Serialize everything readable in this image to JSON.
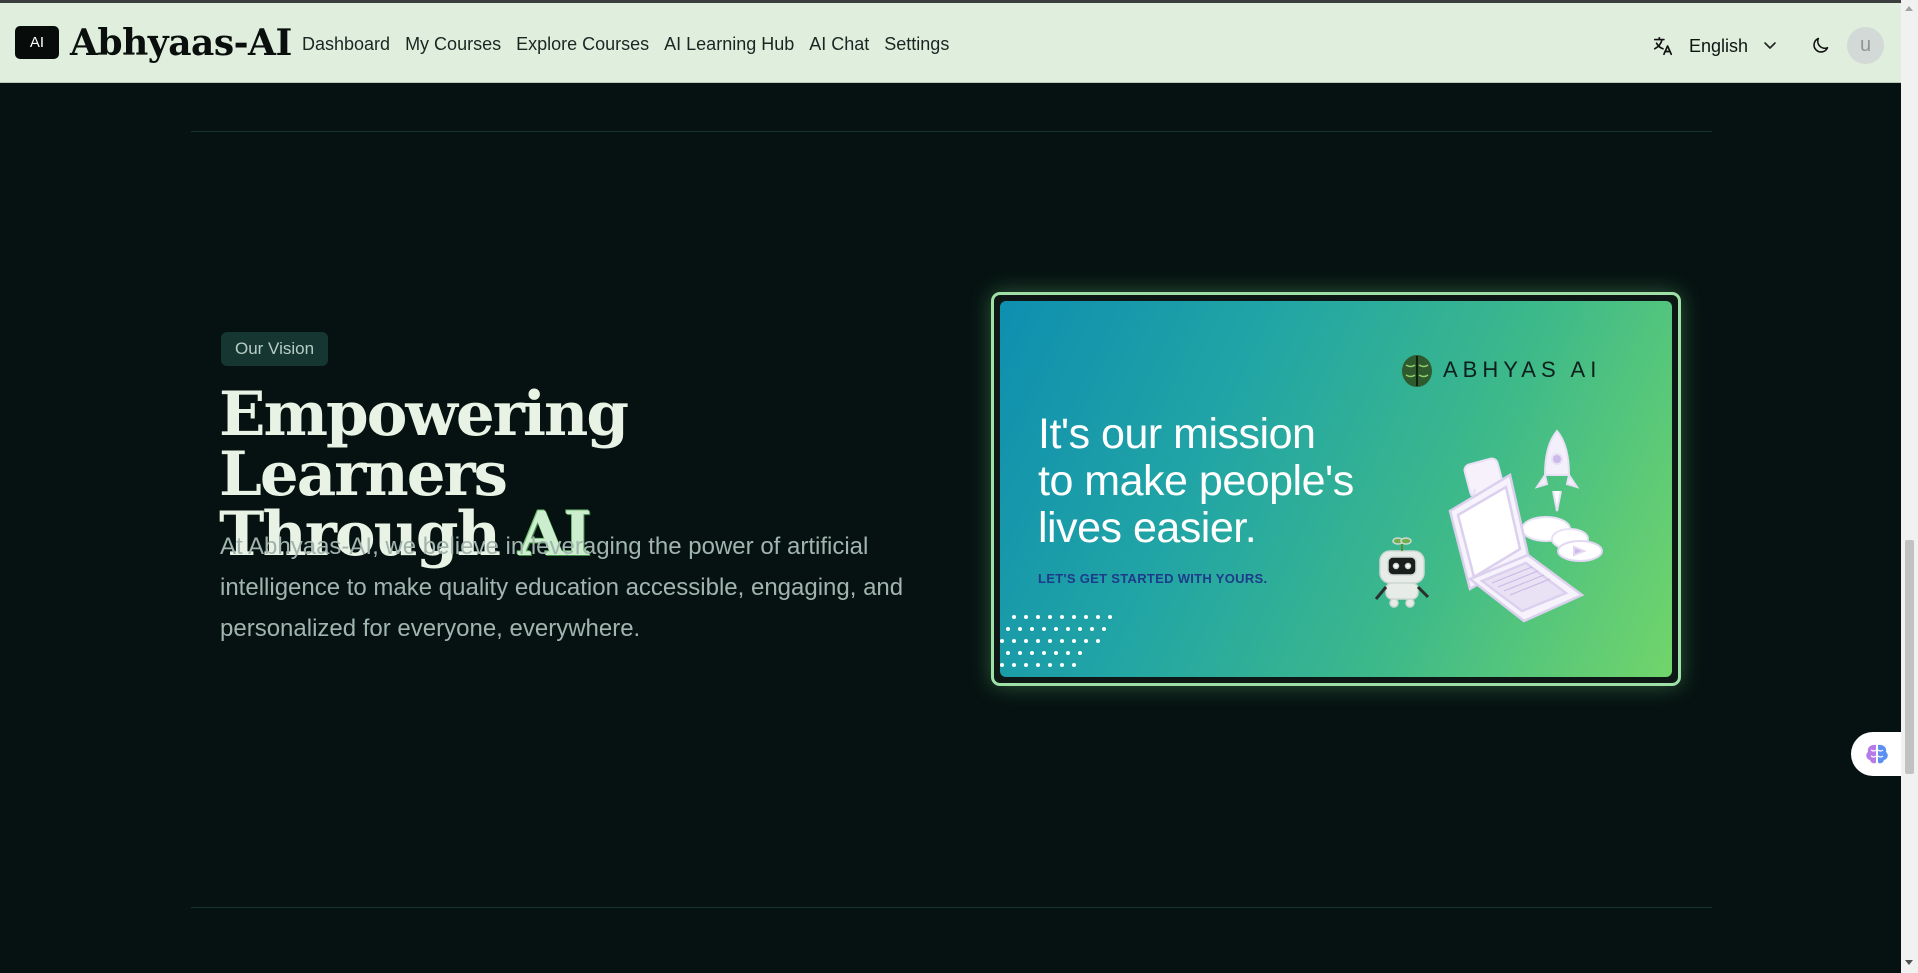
{
  "header": {
    "logo_badge": "AI",
    "brand": "Abhyaas-AI",
    "nav": [
      {
        "label": "Dashboard"
      },
      {
        "label": "My Courses"
      },
      {
        "label": "Explore Courses"
      },
      {
        "label": "AI Learning Hub"
      },
      {
        "label": "AI Chat"
      },
      {
        "label": "Settings"
      }
    ],
    "language": "English",
    "avatar_initial": "u",
    "icons": {
      "language": "translate-icon",
      "dropdown": "chevron-down-icon",
      "theme": "moon-icon"
    }
  },
  "vision": {
    "badge": "Our Vision",
    "headline_line1": "Empowering Learners",
    "headline_line2": "Through",
    "headline_accent": "AI",
    "description": "At Abhyaas-AI, we believe in leveraging the power of artificial intelligence to make quality education accessible, engaging, and personalized for everyone, everywhere."
  },
  "banner": {
    "brand": "ABHYAS AI",
    "mission_line1": "It's our mission",
    "mission_line2": "to make people's",
    "mission_line3": "lives easier.",
    "cta": "LET'S GET STARTED WITH YOURS."
  },
  "widget": {
    "icon": "brain-icon"
  },
  "colors": {
    "background": "#061211",
    "header_bg": "#dfeedd",
    "accent_green": "#9ee0a6",
    "banner_gradient_start": "#0e8fb0",
    "banner_gradient_end": "#72d56a"
  }
}
